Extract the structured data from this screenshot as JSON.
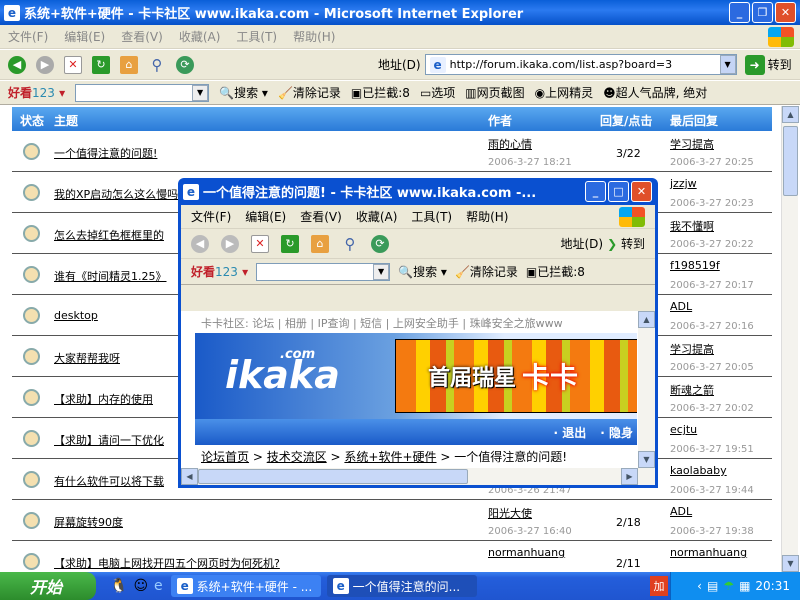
{
  "main_window": {
    "title": "系统+软件+硬件 - 卡卡社区 www.ikaka.com - Microsoft Internet Explorer",
    "menu": [
      "文件(F)",
      "编辑(E)",
      "查看(V)",
      "收藏(A)",
      "工具(T)",
      "帮助(H)"
    ],
    "address_label": "地址(D)",
    "url": "http://forum.ikaka.com/list.asp?board=3",
    "go_label": "转到"
  },
  "toolbar2": {
    "brand": "好看",
    "brand_num": "123",
    "search": "搜索",
    "clear": "清除记录",
    "blocked": "已拦截:8",
    "options": "选项",
    "screenshot": "网页截图",
    "spirit": "上网精灵",
    "promo": "超人气品牌, 绝对"
  },
  "table": {
    "headers": {
      "status": "状态",
      "subject": "主题",
      "author": "作者",
      "replies": "回复/点击",
      "last": "最后回复"
    },
    "rows": [
      {
        "subject": "一个值得注意的问题!",
        "author": "雨的心情",
        "author_date": "2006-3-27 18:21",
        "count": "3/22",
        "last": "学习提高",
        "last_date": "2006-3-27 20:25"
      },
      {
        "subject": "我的XP启动怎么这么慢吗",
        "author": "",
        "author_date": "",
        "count": "",
        "last": "jzzjw",
        "last_date": "2006-3-27 20:23"
      },
      {
        "subject": "怎么去掉红色框框里的",
        "author": "",
        "author_date": "",
        "count": "",
        "last": "我不懂啊",
        "last_date": "2006-3-27 20:22"
      },
      {
        "subject": "谁有《时间精灵1.25》",
        "author": "",
        "author_date": "",
        "count": "",
        "last": "f198519f",
        "last_date": "2006-3-27 20:17"
      },
      {
        "subject": "desktop",
        "author": "",
        "author_date": "",
        "count": "",
        "last": "ADL",
        "last_date": "2006-3-27 20:16"
      },
      {
        "subject": "大家帮帮我呀",
        "author": "",
        "author_date": "",
        "count": "",
        "last": "学习提高",
        "last_date": "2006-3-27 20:05"
      },
      {
        "subject": "【求助】内存的使用",
        "author": "",
        "author_date": "",
        "count": "",
        "last": "断魂之箭",
        "last_date": "2006-3-27 20:02"
      },
      {
        "subject": "【求助】请问一下优化",
        "author": "",
        "author_date": "",
        "count": "",
        "last": "ecjtu",
        "last_date": "2006-3-27 19:51"
      },
      {
        "subject": "有什么软件可以将下载",
        "author": "",
        "author_date": "2006-3-26 21:47",
        "count": "",
        "last": "kaolababy",
        "last_date": "2006-3-27 19:44"
      },
      {
        "subject": "屏幕旋转90度",
        "author": "阳光大使",
        "author_date": "2006-3-27 16:40",
        "count": "2/18",
        "last": "ADL",
        "last_date": "2006-3-27 19:38"
      },
      {
        "subject": "【求助】电脑上网找开四五个网页时为何死机?",
        "author": "normanhuang",
        "author_date": "",
        "count": "2/11",
        "last": "normanhuang",
        "last_date": ""
      }
    ]
  },
  "popup": {
    "title": "一个值得注意的问题! - 卡卡社区 www.ikaka.com -...",
    "menu": [
      "文件(F)",
      "编辑(E)",
      "查看(V)",
      "收藏(A)",
      "工具(T)",
      "帮助(H)"
    ],
    "address_label": "地址(D)",
    "go_label": "转到",
    "toolbar2": {
      "brand": "好看",
      "brand_num": "123",
      "search": "搜索",
      "clear": "清除记录",
      "blocked": "已拦截:8"
    },
    "site_nav": "卡卡社区: 论坛 | 相册 | IP查询 | 短信 | 上网安全助手 | 珠峰安全之旅www",
    "logo": "ikaka",
    "logo_com": ".com",
    "ad_text": "首届瑞星",
    "ad_highlight": "卡卡",
    "bar_links": [
      "· 退出",
      "· 隐身"
    ],
    "breadcrumb": [
      "论坛首页",
      "技术交流区",
      "系统+软件+硬件"
    ],
    "breadcrumb_current": "一个值得注意的问题!"
  },
  "taskbar": {
    "start": "开始",
    "tasks": [
      "系统+软件+硬件 - ...",
      "一个值得注意的问..."
    ],
    "clock": "20:31",
    "tray_badge": "加"
  }
}
